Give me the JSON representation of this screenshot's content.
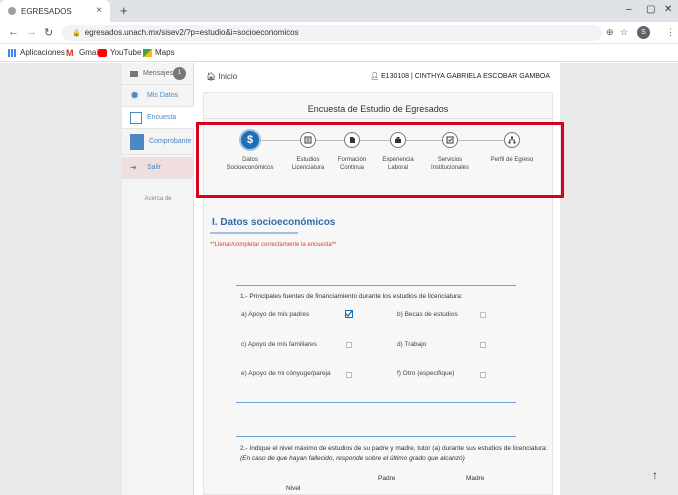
{
  "browser": {
    "tab_title": "EGRESADOS",
    "tab_close": "×",
    "new_tab": "+",
    "url": "egresados.unach.mx/sisev2/?p=estudio&i=socioeconomicos",
    "profile_letter": "S",
    "bookmarks": [
      "Aplicaciones",
      "Gmail",
      "YouTube",
      "Maps"
    ]
  },
  "sidebar": {
    "items": [
      {
        "label": "Mensajes",
        "badge": "1"
      },
      {
        "label": "Mis Datos"
      },
      {
        "label": "Encuesta"
      },
      {
        "label": "Comprobante"
      },
      {
        "label": "Salir"
      }
    ],
    "about": "Acerca de"
  },
  "topbar": {
    "home_label": "Inicio",
    "user": "E130108 | CINTHYA GABRIELA ESCOBAR GAMBOA"
  },
  "survey": {
    "title": "Encuesta de Estudio de Egresados",
    "steps": [
      {
        "label_1": "Datos",
        "label_2": "Socioeconómicos",
        "icon": "dollar-icon",
        "active": true
      },
      {
        "label_1": "Estudios",
        "label_2": "Licenciatura",
        "icon": "book-icon",
        "active": false
      },
      {
        "label_1": "Formación",
        "label_2": "Continua",
        "icon": "file-icon",
        "active": false
      },
      {
        "label_1": "Experiencia",
        "label_2": "Laboral",
        "icon": "briefcase-icon",
        "active": false
      },
      {
        "label_1": "Servicios",
        "label_2": "Institucionales",
        "icon": "check-square-icon",
        "active": false
      },
      {
        "label_1": "Perfil de Egreso",
        "label_2": "",
        "icon": "sitemap-icon",
        "active": false
      }
    ]
  },
  "section": {
    "title": "I. Datos socioeconómicos",
    "warning": "**Llenar/completar correctamente la encuesta**"
  },
  "question1": {
    "text": "1.- Principales fuentes de financiamiento durante los estudios de licenciatura:",
    "options": [
      {
        "label": "a) Apoyo de mis padres",
        "checked": true
      },
      {
        "label": "b) Becas de estudios",
        "checked": false
      },
      {
        "label": "c) Apoyo de mis familiares",
        "checked": false
      },
      {
        "label": "d) Trabajo",
        "checked": false
      },
      {
        "label": "e) Apoyo de mi cónyuge/pareja",
        "checked": false
      },
      {
        "label": "f) Otro (especifique)",
        "checked": false
      }
    ]
  },
  "question2": {
    "text": "2.- Indique el nivel máximo de estudios de su padre y madre, tutor (a) durante sus estudios de licenciatura:",
    "note": "(En caso de que hayan fallecido, responde sobre el último grado que alcanzó)",
    "col_padre": "Padre",
    "col_madre": "Madre",
    "row_header": "Nivel"
  },
  "colors": {
    "accent": "#1f6fb5",
    "link": "#4a87c3",
    "warning": "#d43c3c",
    "highlight": "#d9001b"
  }
}
